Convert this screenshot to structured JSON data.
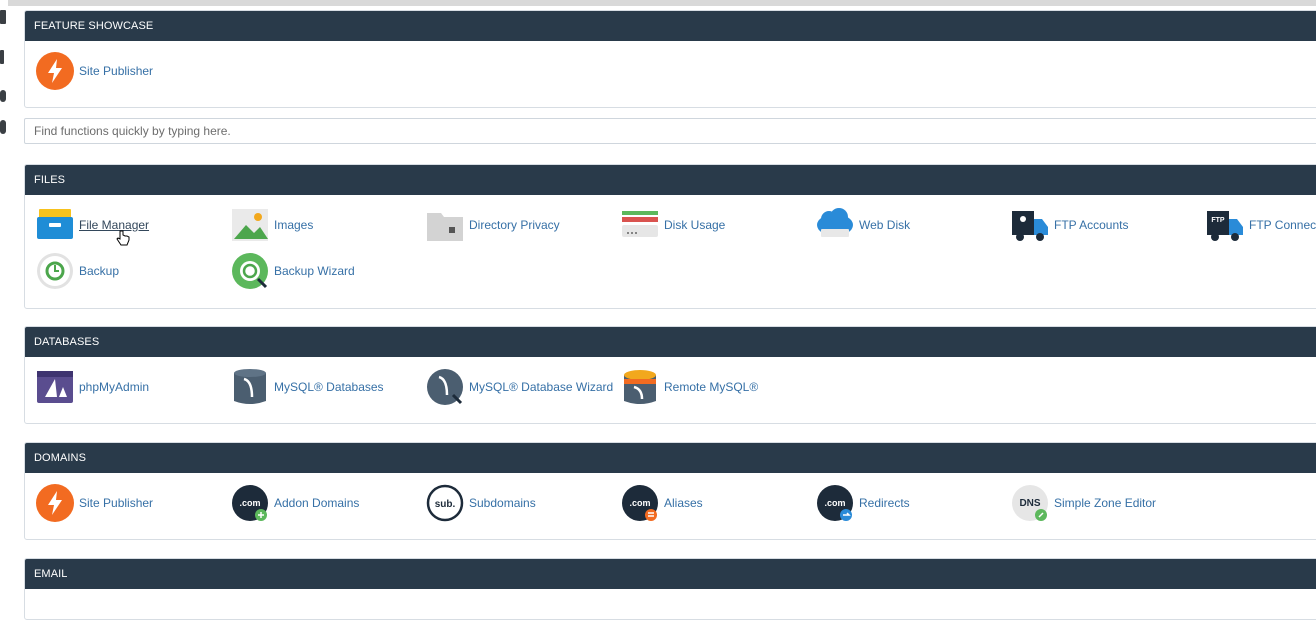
{
  "sections": {
    "feature_showcase": {
      "title": "FEATURE SHOWCASE",
      "items": [
        {
          "label": "Site Publisher",
          "icon": "bolt-icon"
        }
      ]
    },
    "search": {
      "placeholder": "Find functions quickly by typing here."
    },
    "files": {
      "title": "FILES",
      "items": [
        {
          "label": "File Manager",
          "icon": "file-manager-icon"
        },
        {
          "label": "Images",
          "icon": "images-icon"
        },
        {
          "label": "Directory Privacy",
          "icon": "folder-lock-icon"
        },
        {
          "label": "Disk Usage",
          "icon": "disk-usage-icon"
        },
        {
          "label": "Web Disk",
          "icon": "cloud-disk-icon"
        },
        {
          "label": "FTP Accounts",
          "icon": "ftp-truck-icon"
        },
        {
          "label": "FTP Connecti",
          "icon": "ftp-connections-icon"
        },
        {
          "label": "Backup",
          "icon": "backup-icon"
        },
        {
          "label": "Backup Wizard",
          "icon": "backup-wizard-icon"
        }
      ]
    },
    "databases": {
      "title": "DATABASES",
      "items": [
        {
          "label": "phpMyAdmin",
          "icon": "phpmyadmin-icon"
        },
        {
          "label": "MySQL® Databases",
          "icon": "mysql-db-icon"
        },
        {
          "label": "MySQL® Database Wizard",
          "icon": "mysql-wizard-icon"
        },
        {
          "label": "Remote MySQL®",
          "icon": "remote-mysql-icon"
        }
      ]
    },
    "domains": {
      "title": "DOMAINS",
      "items": [
        {
          "label": "Site Publisher",
          "icon": "bolt-icon"
        },
        {
          "label": "Addon Domains",
          "icon": "addon-domains-icon",
          "badge": ".com"
        },
        {
          "label": "Subdomains",
          "icon": "subdomains-icon",
          "badge": "sub."
        },
        {
          "label": "Aliases",
          "icon": "aliases-icon",
          "badge": ".com"
        },
        {
          "label": "Redirects",
          "icon": "redirects-icon",
          "badge": ".com"
        },
        {
          "label": "Simple Zone Editor",
          "icon": "dns-icon",
          "badge": "DNS"
        }
      ]
    },
    "email": {
      "title": "EMAIL"
    }
  },
  "ftp_badge": "FTP",
  "colors": {
    "header_bg": "#293a4a",
    "link": "#3670a6",
    "orange": "#f26b21",
    "navy": "#1d2b3a",
    "green": "#5cb85c"
  }
}
